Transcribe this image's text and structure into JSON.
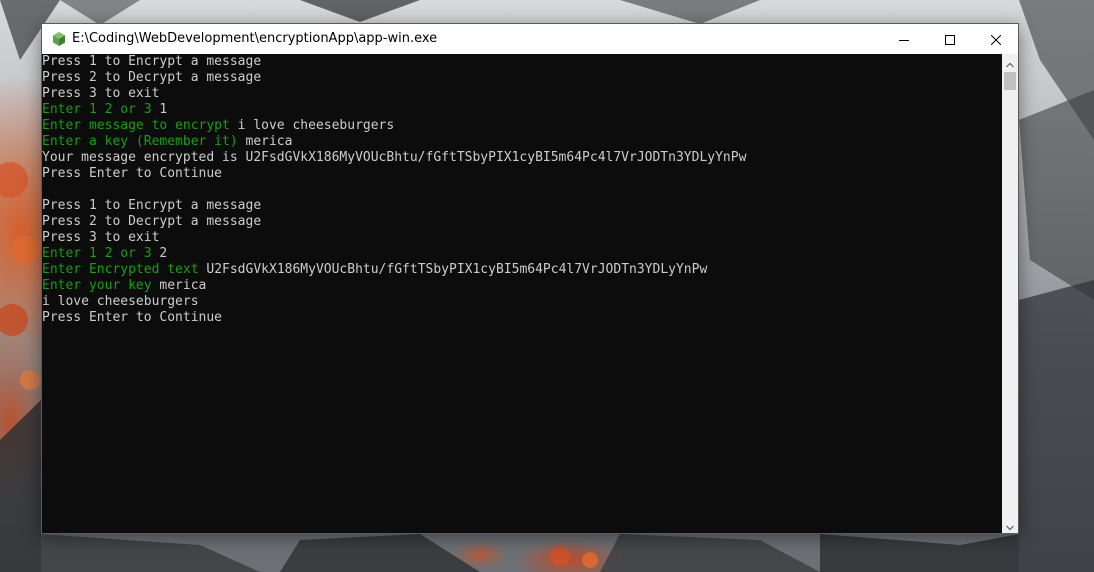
{
  "window": {
    "title": "E:\\Coding\\WebDevelopment\\encryptionApp\\app-win.exe",
    "icon": "nodejs-hex-icon",
    "buttons": {
      "minimize_icon": "minimize-icon",
      "maximize_icon": "maximize-icon",
      "close_icon": "close-icon"
    }
  },
  "colors": {
    "console_bg": "#0c0c0c",
    "text": "#cccccc",
    "prompt_green": "#13a10e"
  },
  "console": {
    "lines": [
      {
        "text": "Press 1 to Encrypt a message"
      },
      {
        "text": "Press 2 to Decrypt a message"
      },
      {
        "text": "Press 3 to exit"
      },
      {
        "prompt": "Enter 1 2 or 3",
        "input": "1"
      },
      {
        "prompt": "Enter message to encrypt",
        "input": "i love cheeseburgers"
      },
      {
        "prompt": "Enter a key (Remember it)",
        "input": "merica"
      },
      {
        "text": "Your message encrypted is U2FsdGVkX186MyVOUcBhtu/fGftTSbyPIX1cyBI5m64Pc4l7VrJODTn3YDLyYnPw"
      },
      {
        "text": "Press Enter to Continue"
      },
      {
        "text": ""
      },
      {
        "text": "Press 1 to Encrypt a message"
      },
      {
        "text": "Press 2 to Decrypt a message"
      },
      {
        "text": "Press 3 to exit"
      },
      {
        "prompt": "Enter 1 2 or 3",
        "input": "2"
      },
      {
        "prompt": "Enter Encrypted text",
        "input": "U2FsdGVkX186MyVOUcBhtu/fGftTSbyPIX1cyBI5m64Pc4l7VrJODTn3YDLyYnPw"
      },
      {
        "prompt": "Enter your key",
        "input": "merica"
      },
      {
        "text": "i love cheeseburgers"
      },
      {
        "text": "Press Enter to Continue"
      }
    ]
  }
}
